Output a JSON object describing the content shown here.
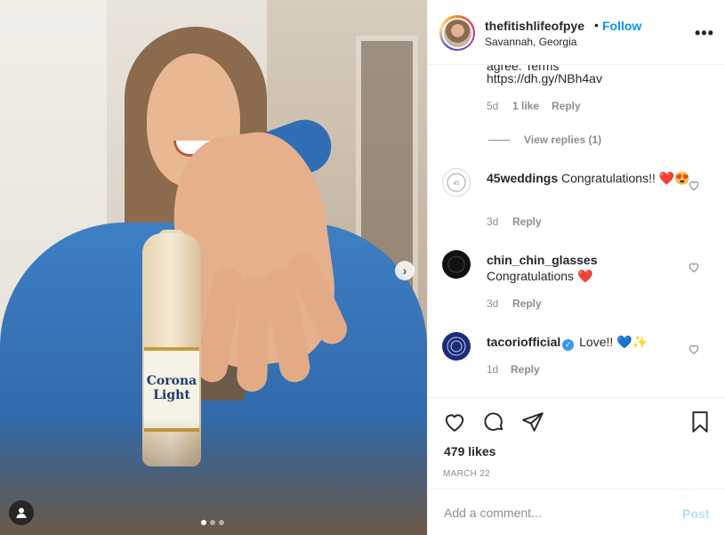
{
  "photo": {
    "bottle_label": "Corona Light"
  },
  "header": {
    "username": "thefitishlifeofpye",
    "separator": "•",
    "follow_label": "Follow",
    "location": "Savannah, Georgia",
    "more_label": "•••"
  },
  "comments": {
    "cut_text": "agree. Terms",
    "cut_url": "https://dh.gy/NBh4av",
    "cut_meta": {
      "age": "5d",
      "likes": "1 like",
      "reply": "Reply"
    },
    "view_replies": "View replies (1)",
    "items": [
      {
        "username": "45weddings",
        "text": "Congratulations!! ❤️😍",
        "age": "3d",
        "reply": "Reply"
      },
      {
        "username": "chin_chin_glasses",
        "text": "Congratulations ❤️",
        "age": "3d",
        "reply": "Reply"
      },
      {
        "username": "tacoriofficial",
        "verified": true,
        "text": "Love!! 💙✨",
        "age": "1d",
        "reply": "Reply"
      }
    ]
  },
  "post": {
    "likes": "479 likes",
    "date": "MARCH 22"
  },
  "composer": {
    "placeholder": "Add a comment...",
    "post_label": "Post"
  },
  "colors": {
    "link_blue": "#0095f6",
    "post_disabled": "#b2dffc",
    "muted": "#8e8e8e",
    "text": "#262626"
  }
}
